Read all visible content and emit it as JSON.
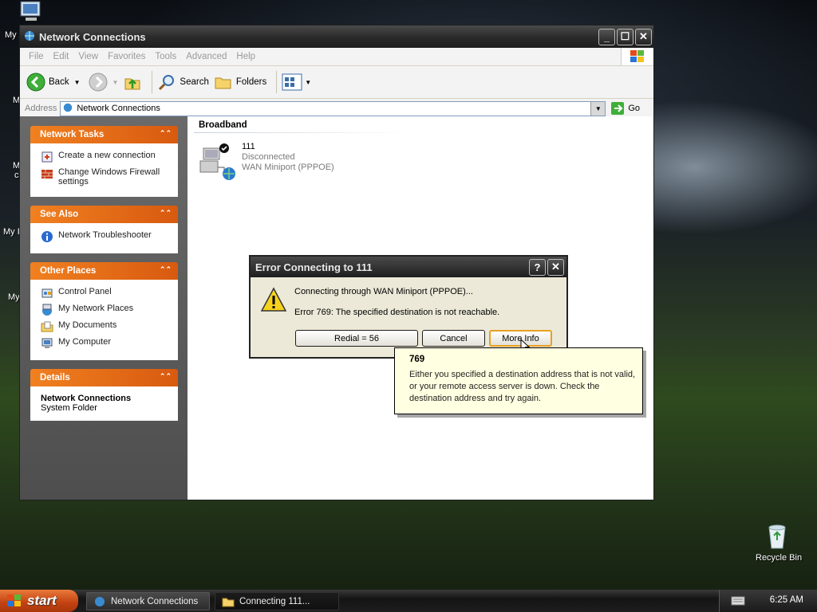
{
  "desktop": {
    "labels": [
      "My",
      "M",
      "M",
      "c",
      "My I",
      "My"
    ],
    "recycle_bin": "Recycle Bin"
  },
  "window": {
    "title": "Network Connections",
    "menu": [
      "File",
      "Edit",
      "View",
      "Favorites",
      "Tools",
      "Advanced",
      "Help"
    ],
    "toolbar": {
      "back": "Back",
      "search": "Search",
      "folders": "Folders"
    },
    "address": {
      "label": "Address",
      "value": "Network Connections",
      "go": "Go"
    }
  },
  "tasks": {
    "network_tasks": {
      "title": "Network Tasks",
      "items": [
        "Create a new connection",
        "Change Windows Firewall settings"
      ]
    },
    "see_also": {
      "title": "See Also",
      "items": [
        "Network Troubleshooter"
      ]
    },
    "other_places": {
      "title": "Other Places",
      "items": [
        "Control Panel",
        "My Network Places",
        "My Documents",
        "My Computer"
      ]
    },
    "details": {
      "title": "Details",
      "name": "Network Connections",
      "type": "System Folder"
    }
  },
  "main": {
    "section": "Broadband",
    "connection": {
      "name": "111",
      "status": "Disconnected",
      "device": "WAN Miniport (PPPOE)"
    }
  },
  "dialog": {
    "title": "Error Connecting to 111",
    "line1": "Connecting through WAN Miniport (PPPOE)...",
    "line2": "Error 769: The specified destination is not reachable.",
    "buttons": {
      "redial": "Redial = 56",
      "cancel": "Cancel",
      "more_info": "More Info"
    }
  },
  "tooltip": {
    "code": "769",
    "text": "Either you specified a destination address that is not valid, or your remote access server is down. Check the destination address and try again."
  },
  "taskbar": {
    "start": "start",
    "buttons": [
      "Network Connections",
      "Connecting 111..."
    ],
    "clock": "6:25 AM"
  },
  "colors": {
    "task_header": "#e0661a",
    "taskbar": "#1e1e1e",
    "tooltip_bg": "#ffffe1"
  }
}
